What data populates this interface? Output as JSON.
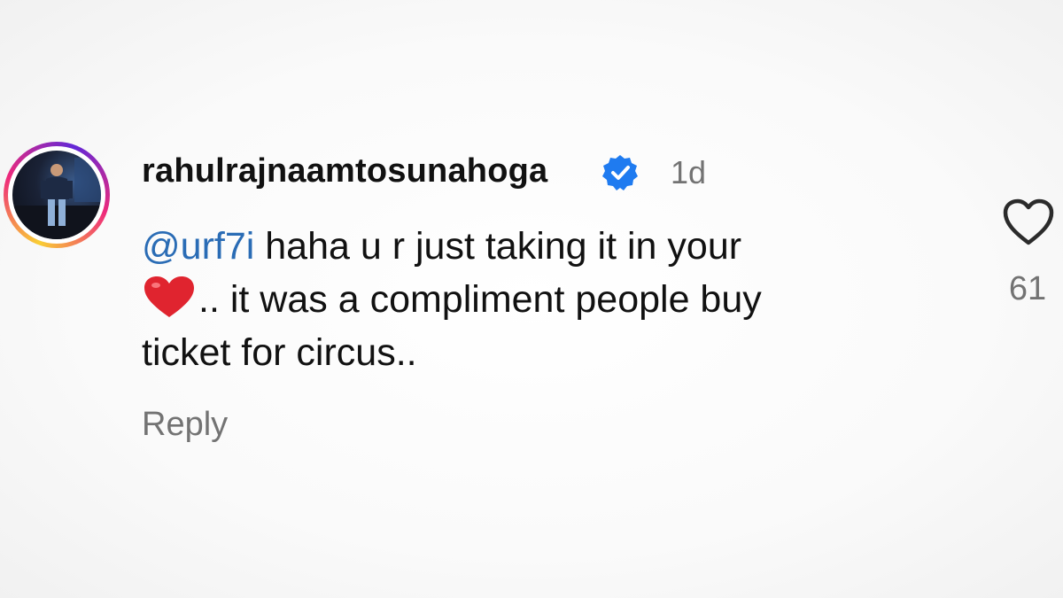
{
  "comment": {
    "username": "rahulrajnaamtosunahoga",
    "verified": true,
    "timestamp": "1d",
    "mention": "@urf7i",
    "text_line1": " haha u r just taking it in your",
    "emoji": "red-heart",
    "text_line2": ".. it was a compliment people buy",
    "text_line3": "ticket for circus..",
    "reply_label": "Reply",
    "like_count": "61"
  },
  "icons": {
    "verified": "verified-badge-icon",
    "like": "heart-outline-icon",
    "emoji": "red-heart-emoji"
  },
  "colors": {
    "mention": "#2a6cb5",
    "verified_badge": "#1f7bf0",
    "muted_text": "#737373",
    "emoji_heart": "#e0242f"
  }
}
